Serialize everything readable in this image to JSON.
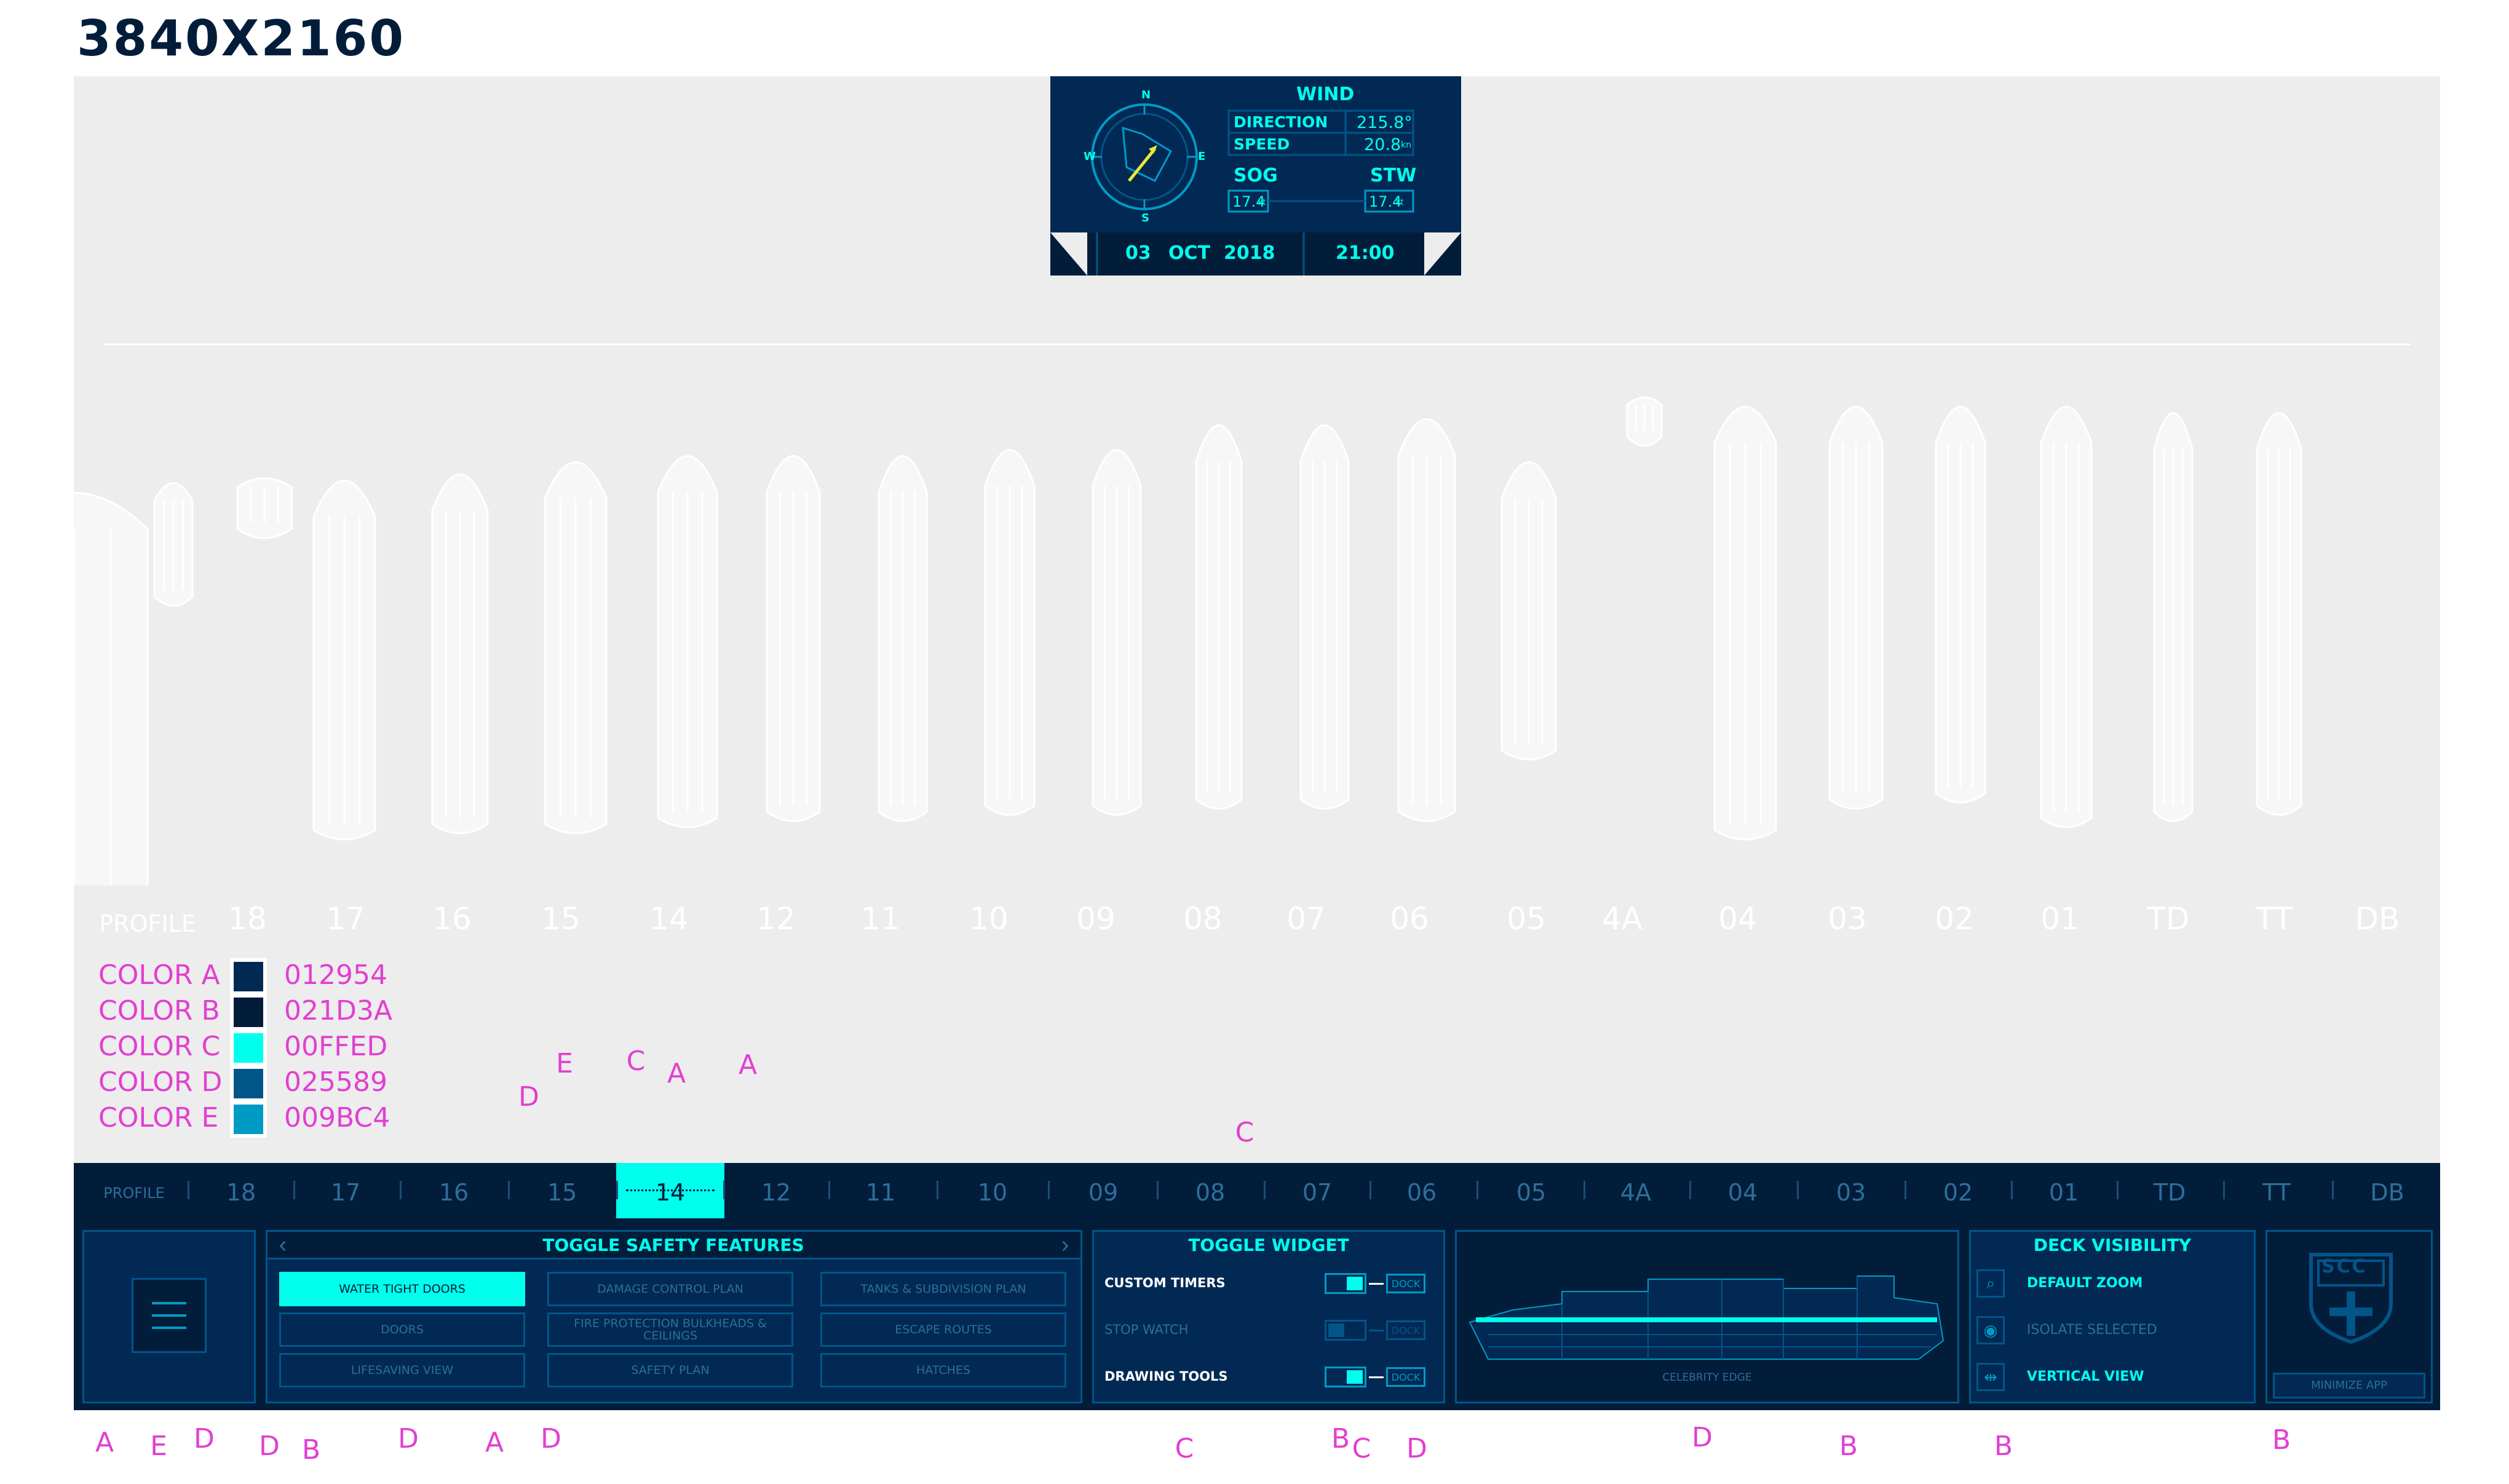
{
  "heading": "3840X2160",
  "hud": {
    "compass": {
      "n": "N",
      "e": "E",
      "s": "S",
      "w": "W"
    },
    "wind_title": "WIND",
    "direction_label": "DIRECTION",
    "direction_value": "215.8°",
    "speed_label": "SPEED",
    "speed_value": "20.8",
    "speed_unit": "kn",
    "sog_label": "SOG",
    "stw_label": "STW",
    "sog_value": "17.4",
    "stw_value": "17.4",
    "kt_unit": "kt",
    "date_day": "03",
    "date_month": "OCT",
    "date_year": "2018",
    "time": "21:00"
  },
  "deck_labels": [
    "PROFILE",
    "18",
    "17",
    "16",
    "15",
    "14",
    "12",
    "11",
    "10",
    "09",
    "08",
    "07",
    "06",
    "05",
    "4A",
    "04",
    "03",
    "02",
    "01",
    "TD",
    "TT",
    "DB"
  ],
  "legend": [
    {
      "name": "COLOR A",
      "hex": "012954",
      "color": "#012954"
    },
    {
      "name": "COLOR B",
      "hex": "021D3A",
      "color": "#021D3A"
    },
    {
      "name": "COLOR C",
      "hex": "00FFED",
      "color": "#00FFED"
    },
    {
      "name": "COLOR D",
      "hex": "025589",
      "color": "#025589"
    },
    {
      "name": "COLOR E",
      "hex": "009BC4",
      "color": "#009BC4"
    }
  ],
  "nav": {
    "labels": [
      "PROFILE",
      "18",
      "17",
      "16",
      "15",
      "14",
      "12",
      "11",
      "10",
      "09",
      "08",
      "07",
      "06",
      "05",
      "4A",
      "04",
      "03",
      "02",
      "01",
      "TD",
      "TT",
      "DB"
    ],
    "selected": "14"
  },
  "safety": {
    "title": "TOGGLE SAFETY FEATURES",
    "prev_icon": "chevron-left-icon",
    "next_icon": "chevron-right-icon",
    "buttons": [
      {
        "label": "WATER TIGHT DOORS",
        "active": true
      },
      {
        "label": "DAMAGE CONTROL PLAN",
        "active": false
      },
      {
        "label": "TANKS & SUBDIVISION PLAN",
        "active": false
      },
      {
        "label": "DOORS",
        "active": false
      },
      {
        "label": "FIRE PROTECTION BULKHEADS & CEILINGS",
        "active": false
      },
      {
        "label": "ESCAPE ROUTES",
        "active": false
      },
      {
        "label": "LIFESAVING VIEW",
        "active": false
      },
      {
        "label": "SAFETY PLAN",
        "active": false
      },
      {
        "label": "HATCHES",
        "active": false
      }
    ]
  },
  "widget": {
    "title": "TOGGLE WIDGET",
    "rows": [
      {
        "label": "CUSTOM TIMERS",
        "on": true,
        "dock": "DOCK"
      },
      {
        "label": "STOP WATCH",
        "on": false,
        "dock": "DOCK"
      },
      {
        "label": "DRAWING TOOLS",
        "on": true,
        "dock": "DOCK"
      }
    ]
  },
  "ship": {
    "caption": "CELEBRITY EDGE"
  },
  "deck_visibility": {
    "title": "DECK VISIBILITY",
    "rows": [
      {
        "label": "DEFAULT ZOOM",
        "icon": "zoom-icon",
        "active": true
      },
      {
        "label": "ISOLATE SELECTED",
        "icon": "eye-icon",
        "active": false
      },
      {
        "label": "VERTICAL VIEW",
        "icon": "vertical-view-icon",
        "active": true
      }
    ]
  },
  "logo": {
    "text": "SCC",
    "minimize_label": "MINIMIZE APP"
  },
  "annotations": {
    "a": "A",
    "b": "B",
    "c": "C",
    "d": "D",
    "e": "E"
  }
}
